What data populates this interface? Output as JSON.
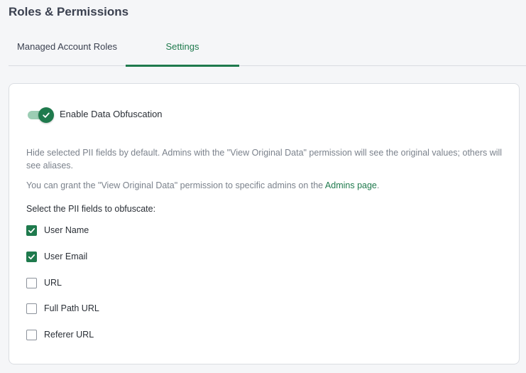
{
  "page": {
    "title": "Roles & Permissions"
  },
  "tabs": [
    {
      "label": "Managed Account Roles",
      "active": false
    },
    {
      "label": "Settings",
      "active": true
    }
  ],
  "settings": {
    "toggle": {
      "label": "Enable Data Obfuscation",
      "enabled": true
    },
    "description": "Hide selected PII fields by default. Admins with the \"View Original Data\" permission will see the original values; others will see aliases.",
    "grant_text_before": "You can grant the \"View Original Data\" permission to specific admins on the ",
    "grant_link": "Admins page",
    "grant_text_after": ".",
    "select_label": "Select the PII fields to obfuscate:",
    "fields": [
      {
        "label": "User Name",
        "checked": true
      },
      {
        "label": "User Email",
        "checked": true
      },
      {
        "label": "URL",
        "checked": false
      },
      {
        "label": "Full Path URL",
        "checked": false
      },
      {
        "label": "Referer URL",
        "checked": false
      }
    ]
  },
  "colors": {
    "accent": "#1f7a4d",
    "toggle_track": "#9ccdb4"
  },
  "icons": {
    "toggle": "check-icon",
    "checkbox": "check-icon"
  }
}
